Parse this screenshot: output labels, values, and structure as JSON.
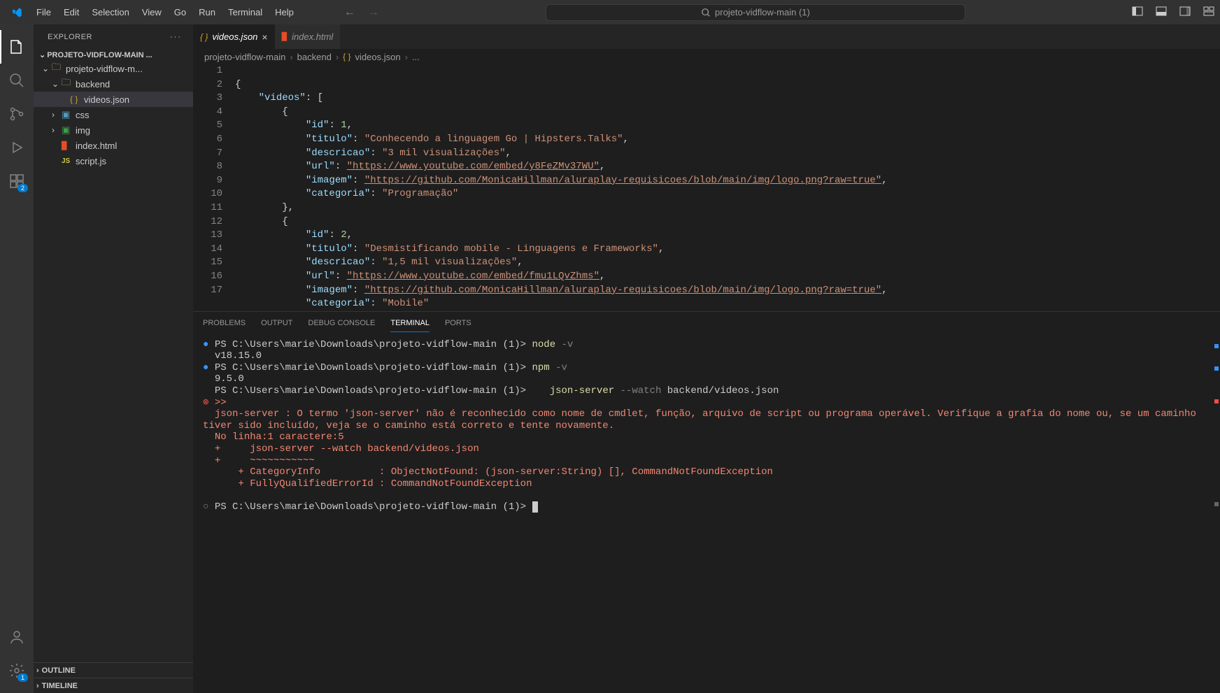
{
  "menu": [
    "File",
    "Edit",
    "Selection",
    "View",
    "Go",
    "Run",
    "Terminal",
    "Help"
  ],
  "search_placeholder": "projeto-vidflow-main (1)",
  "activity_badges": {
    "extensions": "2",
    "settings": "1"
  },
  "explorer": {
    "header": "EXPLORER",
    "project": "PROJETO-VIDFLOW-MAIN ...",
    "tree": {
      "root": "projeto-vidflow-m...",
      "backend": "backend",
      "videosjson": "videos.json",
      "css": "css",
      "img": "img",
      "indexhtml": "index.html",
      "scriptjs": "script.js"
    },
    "outline": "OUTLINE",
    "timeline": "TIMELINE"
  },
  "tabs": {
    "active": "videos.json",
    "other": "index.html"
  },
  "breadcrumbs": {
    "p1": "projeto-vidflow-main",
    "p2": "backend",
    "p3": "videos.json",
    "p4": "..."
  },
  "code": {
    "lines": [
      1,
      2,
      3,
      4,
      5,
      6,
      7,
      8,
      9,
      10,
      11,
      12,
      13,
      14,
      15,
      16,
      17
    ],
    "l1": "{",
    "l2_key": "\"videos\"",
    "l2_rest": ": [",
    "l3": "{",
    "l4_k": "\"id\"",
    "l4_v": "1",
    "l5_k": "\"titulo\"",
    "l5_v": "\"Conhecendo a linguagem Go | Hipsters.Talks\"",
    "l6_k": "\"descricao\"",
    "l6_v": "\"3 mil visualizações\"",
    "l7_k": "\"url\"",
    "l7_v": "\"https://www.youtube.com/embed/y8FeZMv37WU\"",
    "l8_k": "\"imagem\"",
    "l8_v": "\"https://github.com/MonicaHillman/aluraplay-requisicoes/blob/main/img/logo.png?raw=true\"",
    "l9_k": "\"categoria\"",
    "l9_v": "\"Programação\"",
    "l10": "},",
    "l11": "{",
    "l12_k": "\"id\"",
    "l12_v": "2",
    "l13_k": "\"titulo\"",
    "l13_v": "\"Desmistificando mobile - Linguagens e Frameworks\"",
    "l14_k": "\"descricao\"",
    "l14_v": "\"1,5 mil visualizações\"",
    "l15_k": "\"url\"",
    "l15_v": "\"https://www.youtube.com/embed/fmu1LQvZhms\"",
    "l16_k": "\"imagem\"",
    "l16_v": "\"https://github.com/MonicaHillman/aluraplay-requisicoes/blob/main/img/logo.png?raw=true\"",
    "l17_k": "\"categoria\"",
    "l17_v": "\"Mobile\""
  },
  "panel": {
    "tabs": {
      "problems": "PROBLEMS",
      "output": "OUTPUT",
      "debug": "DEBUG CONSOLE",
      "terminal": "TERMINAL",
      "ports": "PORTS"
    },
    "term": {
      "ps": "PS C:\\Users\\marie\\Downloads\\projeto-vidflow-main (1)>",
      "node": "node",
      "v": "-v",
      "node_out": "v18.15.0",
      "npm": "npm",
      "npm_out": "9.5.0",
      "json_server": "json-server",
      "watch": "--watch",
      "path": "backend/videos.json",
      "err1": ">> ",
      "err2": "json-server : O termo 'json-server' não é reconhecido como nome de cmdlet, função, arquivo de script ou programa operável. Verifique a grafia do nome ou, se um caminho tiver sido incluído, veja se o caminho está correto e tente novamente.",
      "err3": "No linha:1 caractere:5",
      "err4": "+     json-server --watch backend/videos.json",
      "err5": "+     ~~~~~~~~~~~",
      "err6": "    + CategoryInfo          : ObjectNotFound: (json-server:String) [], CommandNotFoundException",
      "err7": "    + FullyQualifiedErrorId : CommandNotFoundException"
    }
  }
}
